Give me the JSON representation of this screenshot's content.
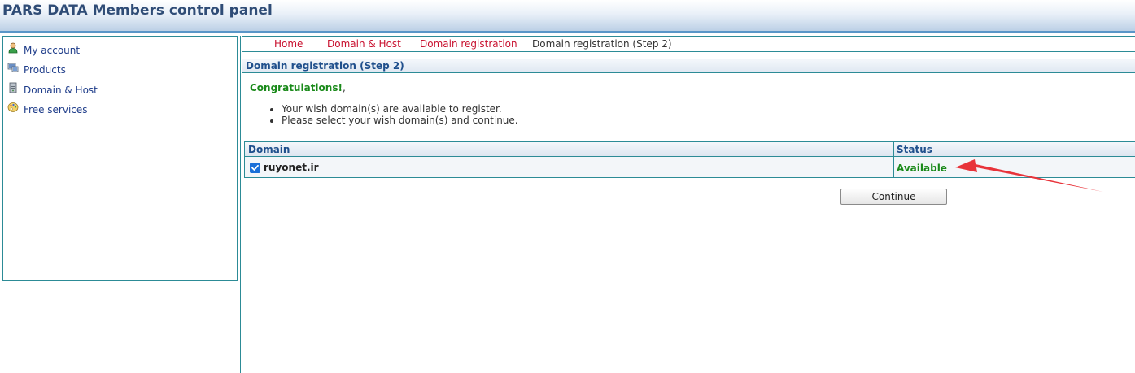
{
  "header": {
    "title": "PARS DATA Members control panel"
  },
  "sidebar": {
    "items": [
      {
        "label": "My account",
        "icon": "user-icon"
      },
      {
        "label": "Products",
        "icon": "products-icon"
      },
      {
        "label": "Domain & Host",
        "icon": "server-icon"
      },
      {
        "label": "Free services",
        "icon": "palette-icon"
      }
    ]
  },
  "breadcrumb": {
    "items": [
      "Home",
      "Domain & Host",
      "Domain registration"
    ],
    "current": "Domain registration (Step 2)"
  },
  "section": {
    "title": "Domain registration (Step 2)"
  },
  "message": {
    "congrats": "Congratulations!",
    "suffix": ",",
    "bullets": [
      "Your wish domain(s) are available to register.",
      "Please select your wish domain(s) and continue."
    ]
  },
  "table": {
    "headers": {
      "domain": "Domain",
      "status": "Status"
    },
    "rows": [
      {
        "domain": "ruyonet.ir",
        "status": "Available",
        "checked": true
      }
    ]
  },
  "actions": {
    "continue_label": "Continue"
  },
  "colors": {
    "link": "#c8102e",
    "accent": "#2c8b96",
    "available": "#1a8a1a",
    "arrow": "#e8333a"
  }
}
